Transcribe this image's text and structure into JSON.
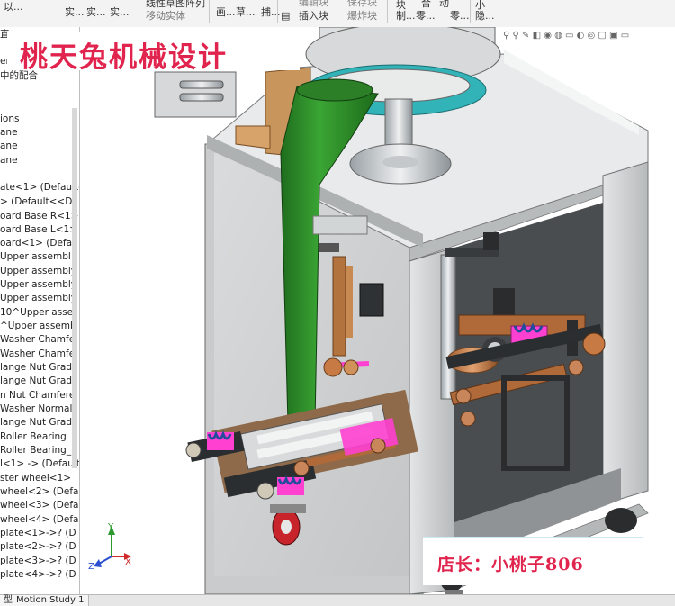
{
  "ribbon": {
    "labels": [
      "实...",
      "实...",
      "实...",
      "移动实体",
      "画...",
      "草...",
      "捕...",
      "插入块",
      "爆炸块",
      "块",
      "制...",
      "零...",
      "零...",
      "小",
      "隐..."
    ],
    "top_fragments": [
      "以...",
      "...",
      "...",
      "线性草图阵列",
      "...",
      "...",
      "编辑块",
      "保存块",
      "块",
      "合",
      "动",
      "..."
    ]
  },
  "tree": {
    "items": [
      "直",
      "em",
      "中的配合",
      "ions",
      "ane",
      "ane",
      "ane",
      "ate<1> (Default-",
      "> (Default<<D",
      "oard Base R<1>",
      "oard Base L<1>",
      "oard<1> (Defau",
      "Upper assembl",
      "Upper assembly",
      "Upper assembly",
      "Upper assembly",
      "10^Upper asse",
      "^Upper assemb",
      "Washer Chamfe",
      "Washer Chamfe",
      "lange Nut Grad",
      "lange Nut Grad",
      "n Nut Chamfere",
      "Washer Normal",
      "lange Nut Grad",
      "Roller Bearing",
      "Roller Bearing_",
      "l<1> -> (Default<",
      "ster wheel<1>",
      "wheel<2> (Defau",
      "wheel<3> (Defau",
      "wheel<4> (Defau",
      "plate<1>->? (D",
      "plate<2>->? (D",
      "plate<3>->? (D",
      "plate<4>->? (D"
    ]
  },
  "bottom": {
    "tabs": [
      "型",
      "Motion Study 1"
    ]
  },
  "viewport": {
    "toolbar_glyphs": "⚲ ⚲ ✎ ◧ ◉ ◍ ▭ ◐ ◎ ▢ ▣ ▭"
  },
  "triad": {
    "x": "X",
    "y": "Y",
    "z": "Z"
  },
  "watermark": {
    "text": "桃天兔机械设计"
  },
  "shop": {
    "label": "店长：",
    "name": "小桃子806"
  },
  "colors": {
    "frame": "#c9cccd",
    "panel": "#d4d6d7",
    "green_chute": "#2f8d2a",
    "teal_ring": "#31b3b8",
    "accent_pink": "#ff40d0",
    "wheel_red": "#c8242b",
    "watermark_red": "#e0244d"
  }
}
